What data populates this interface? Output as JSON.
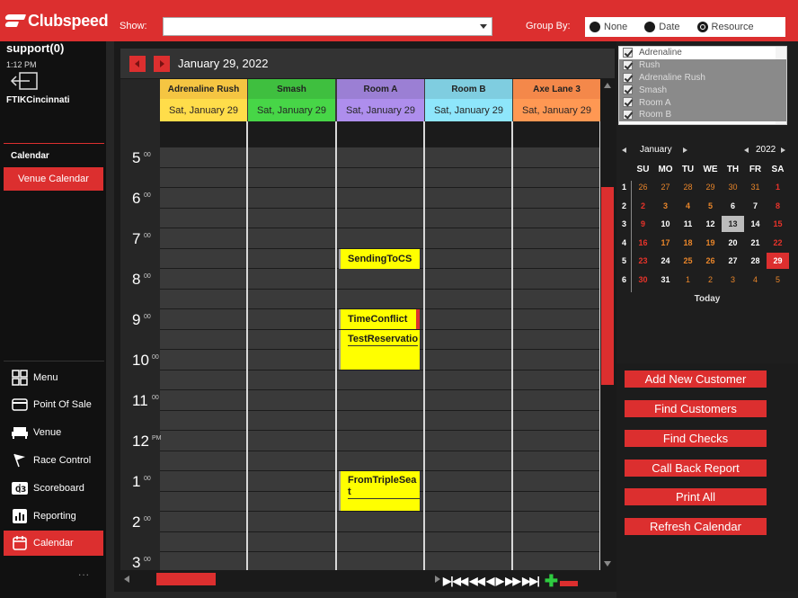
{
  "brand": {
    "name": "Clubspeed"
  },
  "toolbar": {
    "show_label": "Show:",
    "show_value": "",
    "group_by_label": "Group By:",
    "group_options": [
      {
        "label": "None",
        "selected": false
      },
      {
        "label": "Date",
        "selected": false
      },
      {
        "label": "Resource",
        "selected": true
      }
    ]
  },
  "user": {
    "name": "support(0)",
    "time": "1:12 PM",
    "site": "FTIKCincinnati"
  },
  "sidebar": {
    "section_title": "Calendar",
    "venue_calendar": "Venue Calendar",
    "nav": [
      {
        "label": "Menu",
        "icon": "grid-icon",
        "active": false
      },
      {
        "label": "Point Of Sale",
        "icon": "card-icon",
        "active": false
      },
      {
        "label": "Venue",
        "icon": "sofa-icon",
        "active": false
      },
      {
        "label": "Race Control",
        "icon": "flag-icon",
        "active": false
      },
      {
        "label": "Scoreboard",
        "icon": "scoreboard-icon",
        "active": false
      },
      {
        "label": "Reporting",
        "icon": "chart-icon",
        "active": false
      },
      {
        "label": "Calendar",
        "icon": "calendar-icon",
        "active": true
      }
    ],
    "more": "..."
  },
  "calendar": {
    "date": "January 29, 2022",
    "columns": [
      {
        "name": "Adrenaline Rush",
        "date": "Sat, January 29",
        "color": "#f5c542"
      },
      {
        "name": "Smash",
        "date": "Sat, January 29",
        "color": "#3fbf3f"
      },
      {
        "name": "Room A",
        "date": "Sat, January 29",
        "color": "#9b7fd4"
      },
      {
        "name": "Room B",
        "date": "Sat, January 29",
        "color": "#7fcde0"
      },
      {
        "name": "Axe Lane 3",
        "date": "Sat, January 29",
        "color": "#f4884a"
      }
    ],
    "hours": [
      {
        "h": "5",
        "s": "00"
      },
      {
        "h": "6",
        "s": "00"
      },
      {
        "h": "7",
        "s": "00"
      },
      {
        "h": "8",
        "s": "00"
      },
      {
        "h": "9",
        "s": "00"
      },
      {
        "h": "10",
        "s": "00"
      },
      {
        "h": "11",
        "s": "00"
      },
      {
        "h": "12",
        "s": "PM"
      },
      {
        "h": "1",
        "s": "00"
      },
      {
        "h": "2",
        "s": "00"
      },
      {
        "h": "3",
        "s": "00"
      }
    ],
    "events": [
      {
        "title": "SendingToCS",
        "column": "Room A",
        "start": "7:30"
      },
      {
        "title": "TimeConflict",
        "column": "Room A",
        "start": "9:00",
        "conflict": true
      },
      {
        "title": "TestReservatio",
        "column": "Room A",
        "start": "9:30"
      },
      {
        "title": "FromTripleSeat",
        "column": "Room A",
        "start": "1:00"
      }
    ],
    "pager_glyphs": "▶|◀◀ ◀◀  ◀   ▶  ▶▶ ▶▶|"
  },
  "resources": [
    {
      "name": "Adrenaline",
      "checked": true
    },
    {
      "name": "Rush",
      "checked": true
    },
    {
      "name": "Adrenaline Rush",
      "checked": true
    },
    {
      "name": "Smash",
      "checked": true
    },
    {
      "name": "Room A",
      "checked": true
    },
    {
      "name": "Room B",
      "checked": true
    }
  ],
  "mini_calendar": {
    "month": "January",
    "year": "2022",
    "dow": [
      "SU",
      "MO",
      "TU",
      "WE",
      "TH",
      "FR",
      "SA"
    ],
    "weeks": [
      "1",
      "2",
      "3",
      "4",
      "5",
      "6"
    ],
    "days": [
      [
        "26",
        "27",
        "28",
        "29",
        "30",
        "31",
        "1"
      ],
      [
        "2",
        "3",
        "4",
        "5",
        "6",
        "7",
        "8"
      ],
      [
        "9",
        "10",
        "11",
        "12",
        "13",
        "14",
        "15"
      ],
      [
        "16",
        "17",
        "18",
        "19",
        "20",
        "21",
        "22"
      ],
      [
        "23",
        "24",
        "25",
        "26",
        "27",
        "28",
        "29"
      ],
      [
        "30",
        "31",
        "1",
        "2",
        "3",
        "4",
        "5"
      ]
    ],
    "today_day": "13",
    "selected_day": "29",
    "today_label": "Today"
  },
  "actions": [
    "Add New Customer",
    "Find Customers",
    "Find Checks",
    "Call Back Report",
    "Print All",
    "Refresh Calendar"
  ],
  "colors": {
    "accent": "#dc2f2f",
    "event": "#ffff00"
  }
}
